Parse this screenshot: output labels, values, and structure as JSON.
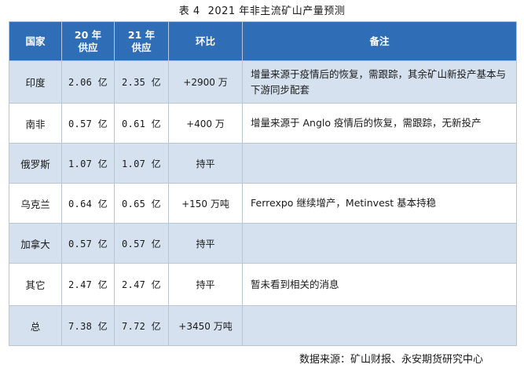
{
  "table_title": {
    "prefix": "表 4",
    "text": "2021 年非主流矿山产量预测"
  },
  "headers": [
    "国家",
    "20 年 供应",
    "21 年 供应",
    "环比",
    "备注"
  ],
  "rows": [
    {
      "country": "印度",
      "supply20": "2.06 亿",
      "supply21": "2.35 亿",
      "change": "+2900 万",
      "note": "增量来源于疫情后的恢复，需跟踪，其余矿山新投产基本与下游同步配套"
    },
    {
      "country": "南非",
      "supply20": "0.57 亿",
      "supply21": "0.61 亿",
      "change": "+400 万",
      "note": "增量来源于 Anglo 疫情后的恢复，需跟踪，无新投产"
    },
    {
      "country": "俄罗斯",
      "supply20": "1.07 亿",
      "supply21": "1.07 亿",
      "change": "持平",
      "note": ""
    },
    {
      "country": "乌克兰",
      "supply20": "0.64 亿",
      "supply21": "0.65 亿",
      "change": "+150 万吨",
      "note": "Ferrexpo 继续增产，Metinvest 基本持稳"
    },
    {
      "country": "加拿大",
      "supply20": "0.57 亿",
      "supply21": "0.57 亿",
      "change": "持平",
      "note": ""
    },
    {
      "country": "其它",
      "supply20": "2.47 亿",
      "supply21": "2.47 亿",
      "change": "持平",
      "note": "暂未看到相关的消息"
    },
    {
      "country": "总",
      "supply20": "7.38 亿",
      "supply21": "7.72 亿",
      "change": "+3450 万吨",
      "note": ""
    }
  ],
  "source": "数据来源：矿山财报、永安期货研究中心",
  "colors": {
    "header_bg": "#2f6db6",
    "band_bg": "#d5e1ef",
    "border": "#b9c6d6"
  }
}
